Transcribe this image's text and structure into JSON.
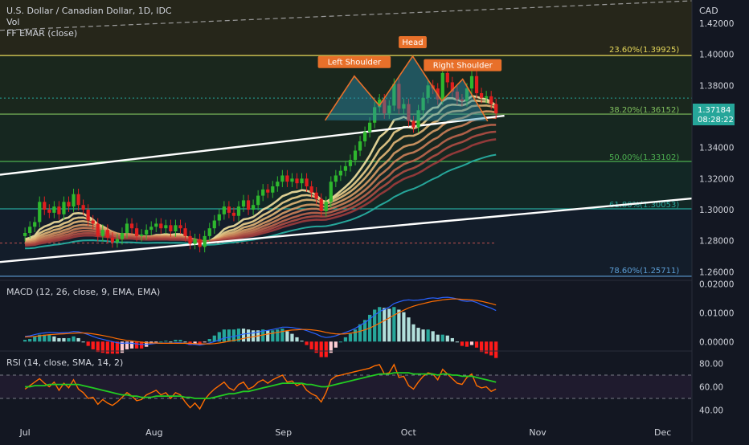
{
  "header": {
    "symbol": "U.S. Dollar / Canadian Dollar, 1D, IDC",
    "line2": "Vol",
    "line3": "FF EMAR (close)"
  },
  "axis": {
    "currency": "CAD"
  },
  "colors": {
    "background": "#131722",
    "bull": "#26a69a",
    "bear": "#ef5350",
    "green_candle": "#2eb82e",
    "red_candle": "#e01f1f",
    "fib_236": "#e6d85a",
    "fib_382": "#7fbf5e",
    "fib_50": "#4caf50",
    "fib_618": "#26a69a",
    "fib_786": "#5c9ed6",
    "pattern": "#e8702a",
    "macd_line": "#2962ff",
    "signal_line": "#ff6d00",
    "rsi_line": "#ff6d00",
    "rsi_ma": "#22cc22"
  },
  "price_badge": {
    "value": "1.37184",
    "time": "08:28:22"
  },
  "annotations": {
    "head": "Head",
    "left_shoulder": "Left Shoulder",
    "right_shoulder": "Right Shoulder"
  },
  "chart_data": [
    {
      "type": "candlestick",
      "title": "U.S. Dollar / Canadian Dollar, 1D, IDC",
      "ylabel": "CAD",
      "ylim": [
        1.255,
        1.435
      ],
      "y_ticks": [
        1.26,
        1.28,
        1.3,
        1.32,
        1.34,
        1.36,
        1.38,
        1.4,
        1.42
      ],
      "y_tick_labels": [
        "1.26000",
        "1.28000",
        "1.30000",
        "1.32000",
        "1.34000",
        "1.36000",
        "1.38000",
        "1.40000",
        "1.42000"
      ],
      "x_labels": [
        {
          "label": "Jul",
          "day": 0
        },
        {
          "label": "Aug",
          "day": 31
        },
        {
          "label": "Sep",
          "day": 62
        },
        {
          "label": "Oct",
          "day": 92
        },
        {
          "label": "Nov",
          "day": 123
        },
        {
          "label": "Dec",
          "day": 153
        }
      ],
      "x_day_range": [
        -6,
        160
      ],
      "fib_levels": [
        {
          "label": "23.60%(1.39925)",
          "value": 1.39925
        },
        {
          "label": "38.20%(1.36152)",
          "value": 1.36152
        },
        {
          "label": "50.00%(1.33102)",
          "value": 1.33102
        },
        {
          "label": "61.80%(1.30053)",
          "value": 1.30053
        },
        {
          "label": "78.60%(1.25711)",
          "value": 1.25711
        }
      ],
      "current_price": 1.37184,
      "closes": [
        1.285,
        1.289,
        1.292,
        1.305,
        1.3,
        1.298,
        1.302,
        1.297,
        1.305,
        1.302,
        1.31,
        1.303,
        1.3,
        1.293,
        1.291,
        1.283,
        1.287,
        1.282,
        1.279,
        1.281,
        1.285,
        1.291,
        1.288,
        1.283,
        1.284,
        1.287,
        1.289,
        1.291,
        1.288,
        1.29,
        1.286,
        1.29,
        1.288,
        1.283,
        1.278,
        1.281,
        1.276,
        1.283,
        1.288,
        1.293,
        1.297,
        1.302,
        1.298,
        1.296,
        1.302,
        1.306,
        1.3,
        1.303,
        1.309,
        1.313,
        1.311,
        1.315,
        1.318,
        1.322,
        1.318,
        1.32,
        1.317,
        1.32,
        1.315,
        1.311,
        1.307,
        1.299,
        1.305,
        1.318,
        1.322,
        1.325,
        1.328,
        1.332,
        1.338,
        1.344,
        1.35,
        1.356,
        1.366,
        1.371,
        1.362,
        1.367,
        1.381,
        1.365,
        1.368,
        1.357,
        1.353,
        1.364,
        1.372,
        1.38,
        1.378,
        1.371,
        1.388,
        1.382,
        1.376,
        1.371,
        1.37,
        1.378,
        1.386,
        1.375,
        1.372,
        1.373,
        1.368,
        1.362
      ],
      "channel_upper": [
        {
          "day": -6,
          "price": 1.3225
        },
        {
          "day": 115,
          "price": 1.3605
        }
      ],
      "channel_lower": [
        {
          "day": -6,
          "price": 1.2663
        },
        {
          "day": 160,
          "price": 1.3072
        }
      ],
      "head_and_shoulders": [
        {
          "day": 72,
          "price": 1.3575
        },
        {
          "day": 79,
          "price": 1.386
        },
        {
          "day": 85,
          "price": 1.367
        },
        {
          "day": 93,
          "price": 1.3988
        },
        {
          "day": 100,
          "price": 1.37
        },
        {
          "day": 105,
          "price": 1.384
        },
        {
          "day": 111,
          "price": 1.357
        }
      ]
    },
    {
      "type": "line",
      "title": "MACD (12, 26, close, 9, EMA, EMA)",
      "ylim": [
        -0.003,
        0.021
      ],
      "y_ticks": [
        0.0,
        0.01,
        0.02
      ],
      "y_tick_labels": [
        "0.00000",
        "0.01000",
        "0.02000"
      ],
      "series": [
        {
          "values": [
            0.0018,
            0.002,
            0.0024,
            0.0028,
            0.003,
            0.0032,
            0.0031,
            0.003,
            0.0031,
            0.0032,
            0.0035,
            0.0034,
            0.003,
            0.0024,
            0.0018,
            0.0012,
            0.0008,
            0.0004,
            0.0,
            -0.0004,
            -0.0006,
            -0.0005,
            -0.0006,
            -0.0008,
            -0.001,
            -0.001,
            -0.0008,
            -0.0006,
            -0.0006,
            -0.0005,
            -0.0006,
            -0.0004,
            -0.0004,
            -0.0006,
            -0.001,
            -0.001,
            -0.0012,
            -0.0009,
            -0.0005,
            0.0,
            0.0006,
            0.0012,
            0.0015,
            0.0018,
            0.0022,
            0.0026,
            0.0028,
            0.003,
            0.0033,
            0.0037,
            0.0039,
            0.0042,
            0.0046,
            0.005,
            0.005,
            0.0049,
            0.0046,
            0.0043,
            0.0038,
            0.0032,
            0.0026,
            0.0018,
            0.0014,
            0.0016,
            0.002,
            0.0026,
            0.0032,
            0.0038,
            0.0046,
            0.0056,
            0.0066,
            0.0078,
            0.0092,
            0.0104,
            0.0112,
            0.012,
            0.0132,
            0.0138,
            0.0143,
            0.0145,
            0.0143,
            0.0144,
            0.0146,
            0.015,
            0.0152,
            0.015,
            0.0153,
            0.0154,
            0.0152,
            0.0148,
            0.0142,
            0.014,
            0.0141,
            0.0136,
            0.0128,
            0.0122,
            0.0116,
            0.0108
          ]
        },
        {
          "values": [
            0.0016,
            0.0017,
            0.0018,
            0.002,
            0.0022,
            0.0024,
            0.0025,
            0.0026,
            0.0027,
            0.0028,
            0.0029,
            0.003,
            0.003,
            0.0029,
            0.0027,
            0.0024,
            0.0021,
            0.0018,
            0.0014,
            0.001,
            0.0007,
            0.0004,
            0.0002,
            0.0,
            -0.0002,
            -0.0004,
            -0.0005,
            -0.0005,
            -0.0006,
            -0.0006,
            -0.0006,
            -0.0006,
            -0.0006,
            -0.0006,
            -0.0006,
            -0.0007,
            -0.0008,
            -0.0008,
            -0.0008,
            -0.0007,
            -0.0005,
            -0.0002,
            0.0001,
            0.0004,
            0.0007,
            0.0011,
            0.0014,
            0.0017,
            0.002,
            0.0023,
            0.0026,
            0.0029,
            0.0032,
            0.0035,
            0.0038,
            0.004,
            0.0041,
            0.0042,
            0.0042,
            0.0041,
            0.0039,
            0.0036,
            0.0032,
            0.0029,
            0.0027,
            0.0026,
            0.0027,
            0.0029,
            0.0032,
            0.0036,
            0.0041,
            0.0047,
            0.0055,
            0.0064,
            0.0073,
            0.0082,
            0.0092,
            0.0101,
            0.0109,
            0.0117,
            0.0123,
            0.0128,
            0.0132,
            0.0136,
            0.014,
            0.0142,
            0.0145,
            0.0147,
            0.0148,
            0.0148,
            0.0147,
            0.0146,
            0.0145,
            0.0143,
            0.014,
            0.0136,
            0.0132,
            0.0127
          ]
        }
      ]
    },
    {
      "type": "line",
      "title": "RSI (14, close, SMA, 14, 2)",
      "ylim": [
        30,
        90
      ],
      "y_ticks": [
        40,
        60,
        80
      ],
      "y_tick_labels": [
        "40.00",
        "60.00",
        "80.00"
      ],
      "bands": [
        50,
        70
      ],
      "series": [
        {
          "values": [
            58,
            61,
            64,
            67,
            63,
            60,
            64,
            57,
            63,
            59,
            66,
            58,
            55,
            50,
            51,
            45,
            49,
            46,
            44,
            47,
            51,
            55,
            52,
            48,
            49,
            53,
            55,
            57,
            53,
            55,
            50,
            55,
            53,
            47,
            42,
            46,
            41,
            49,
            54,
            58,
            61,
            64,
            59,
            57,
            62,
            64,
            58,
            60,
            64,
            66,
            63,
            66,
            68,
            70,
            64,
            65,
            61,
            63,
            57,
            54,
            52,
            47,
            55,
            66,
            69,
            70,
            71,
            72,
            73,
            74,
            75,
            76,
            78,
            79,
            71,
            72,
            79,
            68,
            69,
            61,
            58,
            64,
            69,
            72,
            71,
            66,
            75,
            71,
            67,
            63,
            62,
            68,
            71,
            61,
            59,
            60,
            56,
            58
          ]
        },
        {
          "values": [
            60,
            60,
            61,
            61,
            61,
            62,
            62,
            62,
            62,
            62,
            62,
            62,
            61,
            60,
            59,
            58,
            57,
            56,
            55,
            54,
            53,
            53,
            52,
            52,
            51,
            51,
            51,
            52,
            52,
            52,
            52,
            52,
            52,
            51,
            51,
            50,
            50,
            50,
            50,
            51,
            52,
            53,
            54,
            54,
            55,
            56,
            56,
            57,
            58,
            59,
            60,
            61,
            62,
            63,
            63,
            63,
            63,
            63,
            62,
            62,
            61,
            60,
            60,
            61,
            62,
            63,
            64,
            65,
            66,
            67,
            68,
            69,
            70,
            71,
            71,
            71,
            72,
            72,
            72,
            72,
            71,
            71,
            71,
            71,
            71,
            70,
            71,
            71,
            70,
            70,
            69,
            69,
            69,
            68,
            67,
            66,
            65,
            64
          ]
        }
      ]
    }
  ]
}
